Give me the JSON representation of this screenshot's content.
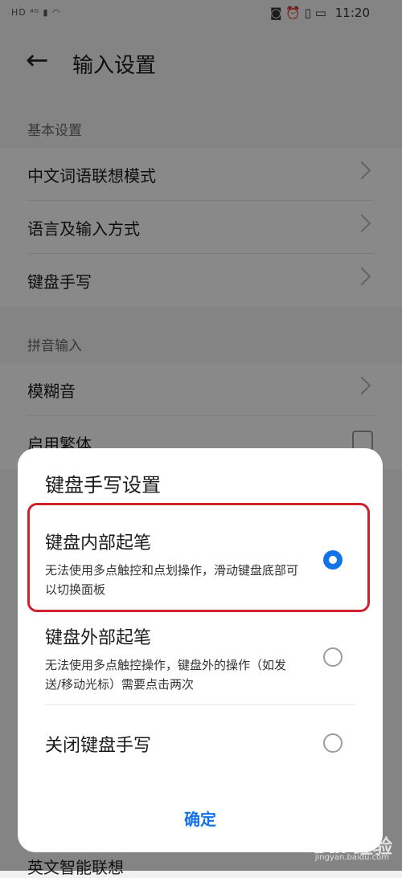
{
  "status_bar": {
    "left_icons": "HD ⁴ᴳ ▮ ◠",
    "right_icons": "◙ ⏰ ▯ ▭",
    "time": "11:20"
  },
  "header": {
    "title": "输入设置"
  },
  "sections": {
    "basic": {
      "title": "基本设置",
      "items": [
        {
          "label": "中文词语联想模式"
        },
        {
          "label": "语言及输入方式"
        },
        {
          "label": "键盘手写"
        }
      ]
    },
    "pinyin": {
      "title": "拼音输入",
      "items": [
        {
          "label": "模糊音"
        },
        {
          "label": "启用繁体"
        }
      ]
    },
    "bottom_item": {
      "label": "英文智能联想"
    }
  },
  "dialog": {
    "title": "键盘手写设置",
    "options": [
      {
        "title": "键盘内部起笔",
        "desc": "无法使用多点触控和点划操作，滑动键盘底部可以切换面板",
        "selected": true
      },
      {
        "title": "键盘外部起笔",
        "desc": "无法使用多点触控操作，键盘外的操作（如发送/移动光标）需要点击两次",
        "selected": false
      },
      {
        "title": "关闭键盘手写",
        "desc": "",
        "selected": false
      }
    ],
    "confirm_label": "确定"
  },
  "watermark": {
    "text": "Bai 经验",
    "sub": "jingyan.baidu.com"
  },
  "colors": {
    "accent": "#1373e6",
    "highlight": "#d0212f"
  }
}
